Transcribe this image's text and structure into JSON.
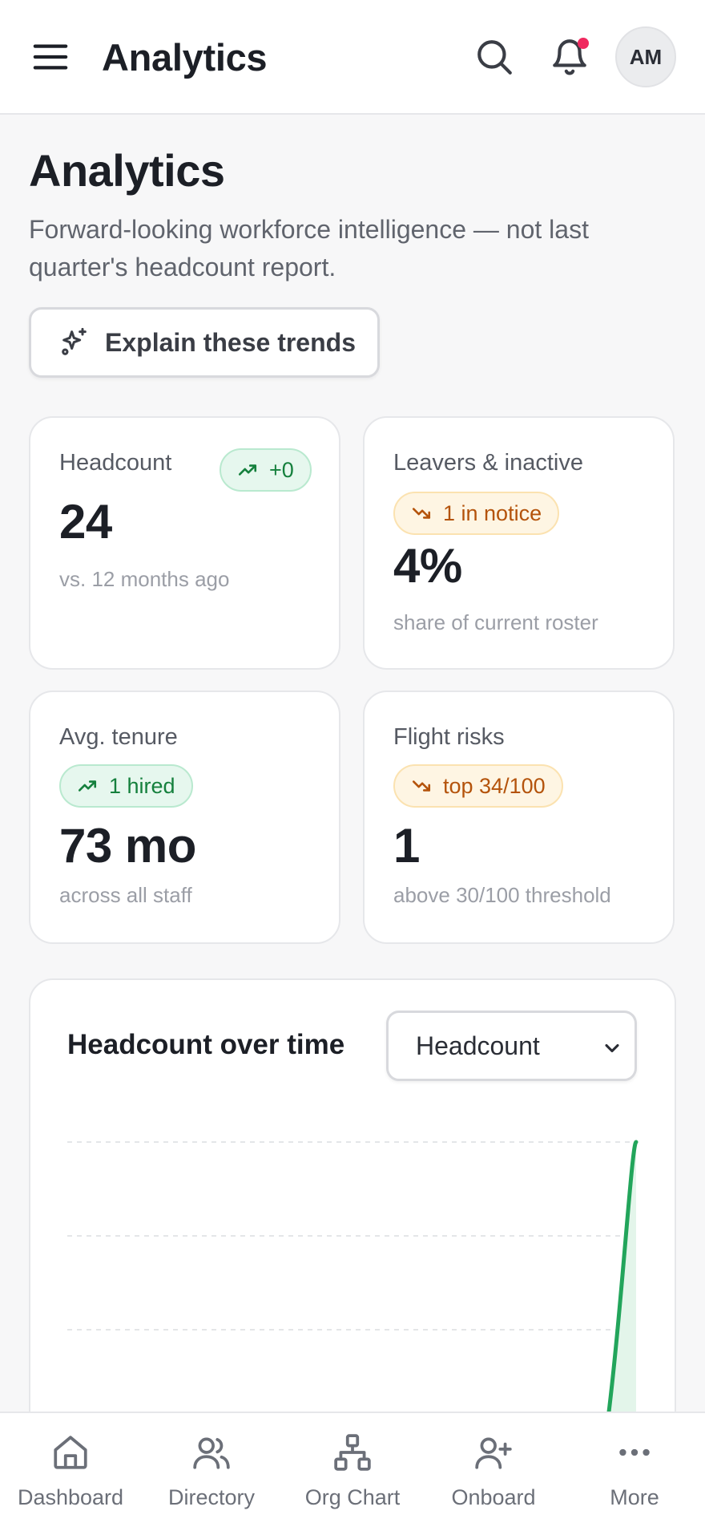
{
  "header": {
    "title": "Analytics",
    "avatar_initials": "AM",
    "notification_dot_color": "#f0295f"
  },
  "page": {
    "title": "Analytics",
    "subtitle": "Forward-looking workforce intelligence — not last quarter's headcount report.",
    "explain_button": "Explain these trends"
  },
  "kpis": {
    "headcount": {
      "label": "Headcount",
      "badge": "+0",
      "badge_trend": "up",
      "value": "24",
      "sub": "vs. 12 months ago"
    },
    "leavers": {
      "label": "Leavers & inactive",
      "badge": "1 in notice",
      "badge_trend": "down",
      "value": "4%",
      "sub": "share of current roster"
    },
    "tenure": {
      "label": "Avg. tenure",
      "badge": "1 hired",
      "badge_trend": "up",
      "value": "73 mo",
      "sub": "across all staff"
    },
    "flight": {
      "label": "Flight risks",
      "badge": "top 34/100",
      "badge_trend": "down",
      "value": "1",
      "sub": "above 30/100 threshold"
    }
  },
  "chart": {
    "title": "Headcount over time",
    "selected_metric": "Headcount"
  },
  "chart_data": {
    "type": "area",
    "title": "Headcount over time",
    "series": [
      {
        "values": [
          0,
          0,
          0,
          0,
          0,
          0,
          0,
          0,
          0,
          0,
          0,
          24
        ]
      }
    ],
    "grid": true,
    "line_color": "#22a55b",
    "fill_color": "#e3f5ea"
  },
  "nav": {
    "items": [
      {
        "label": "Dashboard",
        "icon": "home-icon"
      },
      {
        "label": "Directory",
        "icon": "users-icon"
      },
      {
        "label": "Org Chart",
        "icon": "org-chart-icon"
      },
      {
        "label": "Onboard",
        "icon": "user-plus-icon"
      },
      {
        "label": "More",
        "icon": "more-icon"
      }
    ]
  },
  "colors": {
    "accent_green": "#15803d",
    "accent_amber": "#b4530b",
    "background": "#f7f7f8"
  }
}
